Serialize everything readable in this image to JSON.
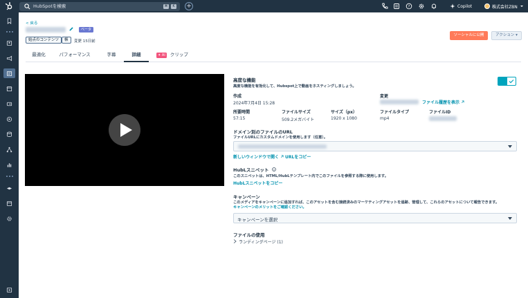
{
  "topbar": {
    "search_placeholder": "HubSpotを検索",
    "kbd_cmd": "⌘",
    "kbd_k": "K",
    "plus": "+",
    "copilot_label": "Copilot",
    "account_name": "株式会社ZBN"
  },
  "header": {
    "back_label": "< 戻る",
    "beta_badge": "ベータ",
    "tag_label": "始点のコンテンツ",
    "small_tag": "帳",
    "changed_label": "変更 15日前",
    "publish_button": "ソーシャルに公開",
    "actions_button": "アクション ▾"
  },
  "tabs": [
    {
      "label": "最適化"
    },
    {
      "label": "パフォーマンス"
    },
    {
      "label": "字幕"
    },
    {
      "label": "詳細"
    },
    {
      "label": "クリップ",
      "badge": "✦ AI"
    }
  ],
  "details": {
    "advanced_title": "高度な機能",
    "advanced_desc": "高度な機能を有効化して、Hubspot上で動画をホスティングしましょう。",
    "created_label": "作成",
    "created_value": "2024年7月4日 15:28",
    "modified_label": "変更",
    "file_history_link": "ファイル履歴を表示",
    "duration_label": "所要時間",
    "duration_value": "57:15",
    "filesize_label": "ファイルサイズ",
    "filesize_value": "509.2メガバイト",
    "dimensions_label": "サイズ（px）",
    "dimensions_value": "1920 x 1080",
    "filetype_label": "ファイルタイプ",
    "filetype_value": "mp4",
    "fileid_label": "ファイルID",
    "domain_title": "ドメイン別のファイルのURL",
    "domain_desc": "ファイルURLにカスタムドメインを使用します（任意）。",
    "open_new_window": "新しいウィンドウで開く",
    "copy_url": "URLをコピー",
    "hubl_title": "HubLスニペット",
    "hubl_desc": "このスニペットは、HTML/HubLテンプレート内でこのファイルを参照する際に使用します。",
    "copy_hubl": "HubLスニペットをコピー",
    "campaign_title": "キャンペーン",
    "campaign_desc": "このメディアをキャンペーンに追加すれば、このアセットを含む接続済みのマーケティングアセットを追跡、管理して、これらのアセットについて報告できます。",
    "campaign_benefits": "キャンペーンのメリットをご確認ください。",
    "campaign_select": "キャンペーンを選択",
    "file_usage_title": "ファイルの使用",
    "landing_pages": "ランディングページ (1)"
  },
  "colors": {
    "nav_bg": "#213343",
    "accent": "#00a4bd",
    "link": "#0091ae",
    "orange": "#ff7a59"
  }
}
